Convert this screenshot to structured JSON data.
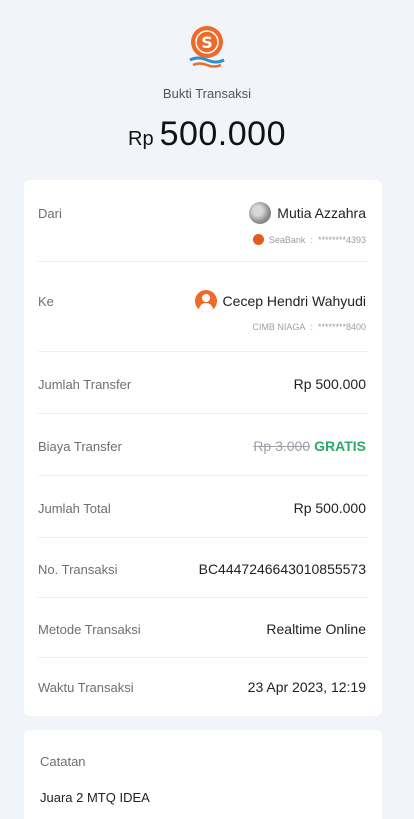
{
  "header": {
    "title": "Bukti Transaksi",
    "currency": "Rp",
    "amount": "500.000",
    "logo_icon": "seabank-logo-icon"
  },
  "sender": {
    "label": "Dari",
    "name": "Mutia Azzahra",
    "bank": "SeaBank",
    "account": "********4393"
  },
  "recipient": {
    "label": "Ke",
    "name": "Cecep Hendri Wahyudi",
    "bank": "CIMB NIAGA",
    "account": "********8400"
  },
  "details": [
    {
      "label": "Jumlah Transfer",
      "value": "Rp 500.000"
    },
    {
      "label": "Biaya Transfer",
      "value_strike": "Rp 3.000",
      "value": "GRATIS"
    },
    {
      "label": "Jumlah Total",
      "value": "Rp 500.000"
    },
    {
      "label": "No. Transaksi",
      "value": "BC4447246643010855573"
    },
    {
      "label": "Metode Transaksi",
      "value": "Realtime Online"
    },
    {
      "label": "Waktu Transaksi",
      "value": "23 Apr 2023, 12:19"
    }
  ],
  "note": {
    "label": "Catatan",
    "text": "Juara 2 MTQ IDEA"
  },
  "colors": {
    "brand": "#ee6a28",
    "accent_blue": "#2f8fd1",
    "free": "#2aa86a"
  }
}
